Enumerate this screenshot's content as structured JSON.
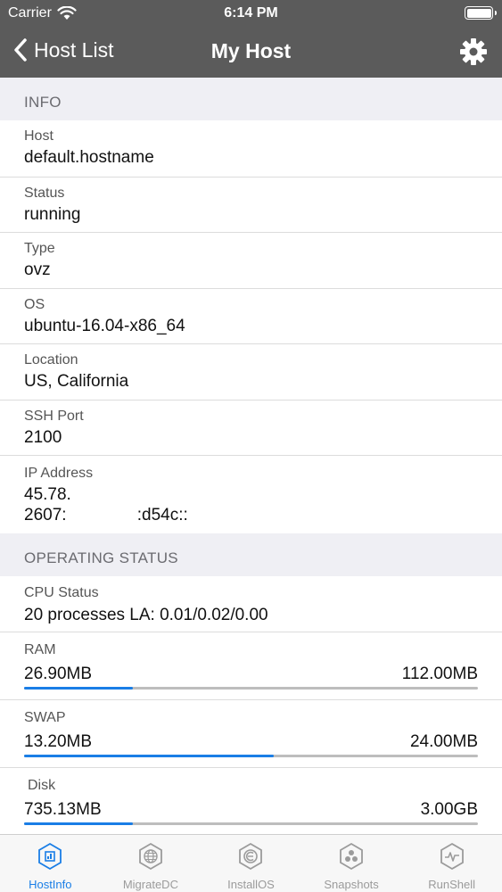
{
  "status_bar": {
    "carrier": "Carrier",
    "time": "6:14 PM"
  },
  "nav": {
    "back_label": "Host List",
    "title": "My Host"
  },
  "info": {
    "header": "INFO",
    "host": {
      "label": "Host",
      "value": "default.hostname"
    },
    "status": {
      "label": "Status",
      "value": "running"
    },
    "type": {
      "label": "Type",
      "value": "ovz"
    },
    "os": {
      "label": "OS",
      "value": "ubuntu-16.04-x86_64"
    },
    "location": {
      "label": "Location",
      "value": "US, California"
    },
    "ssh_port": {
      "label": "SSH Port",
      "value": "2100"
    },
    "ip": {
      "label": "IP Address",
      "ipv4": "45.78.",
      "ipv6": "2607:               :d54c::"
    }
  },
  "operating": {
    "header": "OPERATING STATUS",
    "cpu": {
      "label": "CPU Status",
      "value": "20 processes LA: 0.01/0.02/0.00"
    },
    "ram": {
      "label": "RAM",
      "used": "26.90MB",
      "total": "112.00MB",
      "fraction": 0.24
    },
    "swap": {
      "label": "SWAP",
      "used": "13.20MB",
      "total": "24.00MB",
      "fraction": 0.55
    },
    "disk": {
      "label": "Disk",
      "used": "735.13MB",
      "total": "3.00GB",
      "fraction": 0.24
    }
  },
  "tabs": [
    {
      "label": "HostInfo",
      "icon": "hostinfo-icon",
      "active": true
    },
    {
      "label": "MigrateDC",
      "icon": "globe-icon",
      "active": false
    },
    {
      "label": "InstallOS",
      "icon": "install-icon",
      "active": false
    },
    {
      "label": "Snapshots",
      "icon": "snapshots-icon",
      "active": false
    },
    {
      "label": "RunShell",
      "icon": "shell-icon",
      "active": false
    }
  ],
  "colors": {
    "accent": "#1a7ee6",
    "nav_bg": "#5b5b5b",
    "section_bg": "#efeff4"
  }
}
